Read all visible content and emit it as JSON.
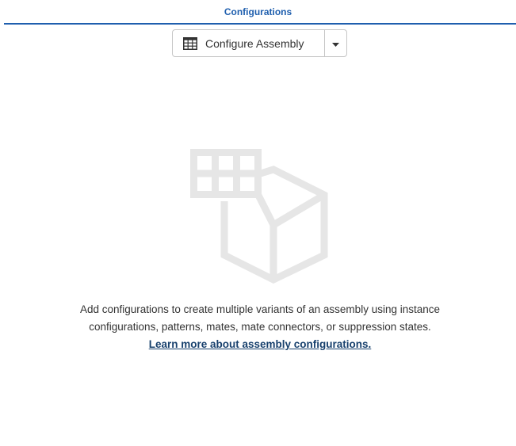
{
  "header": {
    "title": "Configurations",
    "accent_color": "#1f5fae"
  },
  "toolbar": {
    "configure_button_label": "Configure Assembly",
    "configure_icon": "table-icon",
    "dropdown_icon": "caret-down-icon"
  },
  "empty_state": {
    "illustration_icon": "configuration-cube-icon",
    "message": "Add configurations to create multiple variants of an assembly using instance configurations, patterns, mates, mate connectors, or suppression states.",
    "link_text": "Learn more about assembly configurations.",
    "link_color": "#17406d"
  }
}
